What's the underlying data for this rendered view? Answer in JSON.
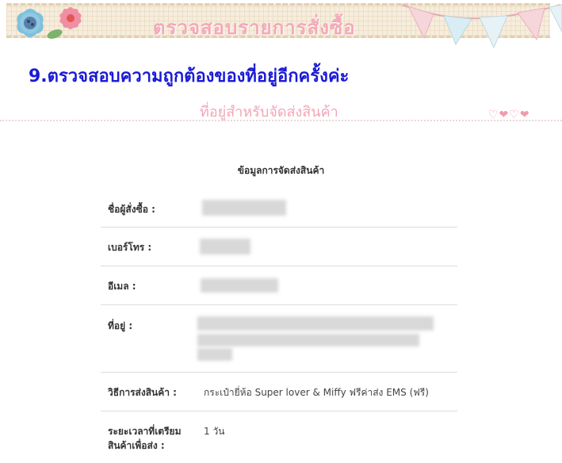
{
  "banner": {
    "title": "ตรวจสอบรายการสั่งซื้อ"
  },
  "heading": "9.ตรวจสอบความถูกต้องของที่อยู่อีกครั้งค่ะ",
  "subheading": "ที่อยู่สำหรับจัดส่งสินค้า",
  "hearts": "♡❤♡❤",
  "section_title": "ข้อมูลการจัดส่งสินค้า",
  "fields": {
    "name_label": "ชื่อผู้สั่งซื้อ :",
    "phone_label": "เบอร์โทร :",
    "email_label": "อีเมล :",
    "address_label": "ที่อยู่ :",
    "shipping_label": "วิธีการส่งสินค้า :",
    "shipping_value": "กระเป๋ายี่ห้อ Super lover & Miffy ฟรีค่าส่ง EMS (ฟรี)",
    "prep_label_1": "ระยะเวลาที่เตรียม",
    "prep_label_2": "สินค้าเพื่อส่ง :",
    "prep_value": "1 วัน"
  },
  "colors": {
    "heading": "#1a1ad6",
    "subheading": "#f3a5b7",
    "banner_title": "#f4a9b8"
  }
}
